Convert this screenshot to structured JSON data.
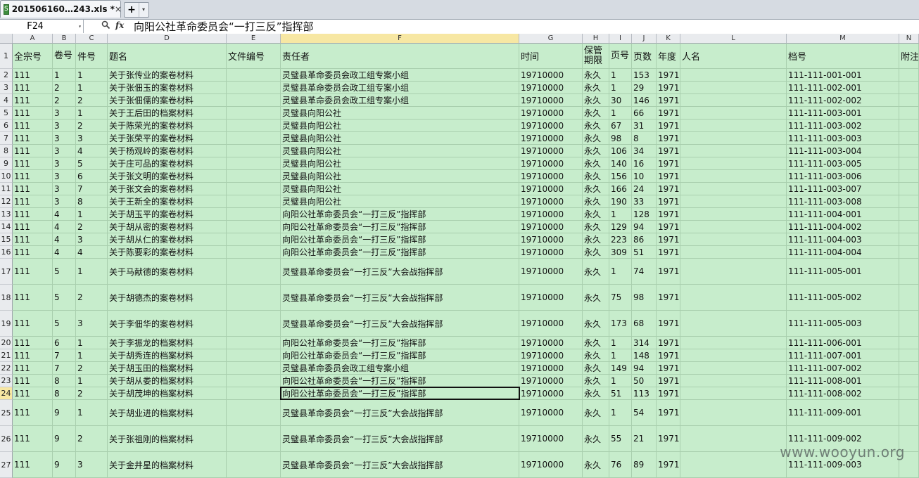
{
  "tab": {
    "title": "201506160…243.xls *",
    "close": "×"
  },
  "newtab": {
    "plus": "+",
    "dropdown": "▾"
  },
  "formula_bar": {
    "name_box": "F24",
    "fx": "fx",
    "formula": "向阳公社革命委员会“一打三反”指挥部"
  },
  "columns": [
    "A",
    "B",
    "C",
    "D",
    "E",
    "F",
    "G",
    "H",
    "I",
    "J",
    "K",
    "L",
    "M",
    "N"
  ],
  "header_row": [
    "全宗号",
    "卷号",
    "件号",
    "题名",
    "文件编号",
    "责任者",
    "时间",
    "保管期限",
    "页号",
    "页数",
    "年度",
    "人名",
    "档号",
    "附注"
  ],
  "rows": [
    [
      "111",
      "1",
      "1",
      "关于张传业的案卷材料",
      "",
      "灵璧县革命委员会政工组专案小组",
      "19710000",
      "永久",
      "1",
      "153",
      "1971",
      "",
      "111-111-001-001",
      ""
    ],
    [
      "111",
      "2",
      "1",
      "关于张佃玉的案卷材料",
      "",
      "灵璧县革命委员会政工组专案小组",
      "19710000",
      "永久",
      "1",
      "29",
      "1971",
      "",
      "111-111-002-001",
      ""
    ],
    [
      "111",
      "2",
      "2",
      "关于张佃儒的案卷材料",
      "",
      "灵璧县革命委员会政工组专案小组",
      "19710000",
      "永久",
      "30",
      "146",
      "1971",
      "",
      "111-111-002-002",
      ""
    ],
    [
      "111",
      "3",
      "1",
      "关于王后田的档案材料",
      "",
      "灵璧县向阳公社",
      "19710000",
      "永久",
      "1",
      "66",
      "1971",
      "",
      "111-111-003-001",
      ""
    ],
    [
      "111",
      "3",
      "2",
      "关于陈荣光的案卷材料",
      "",
      "灵璧县向阳公社",
      "19710000",
      "永久",
      "67",
      "31",
      "1971",
      "",
      "111-111-003-002",
      ""
    ],
    [
      "111",
      "3",
      "3",
      "关于张荣平的案卷材料",
      "",
      "灵璧县向阳公社",
      "19710000",
      "永久",
      "98",
      "8",
      "1971",
      "",
      "111-111-003-003",
      ""
    ],
    [
      "111",
      "3",
      "4",
      "关于杨观岭的案卷材料",
      "",
      "灵璧县向阳公社",
      "19710000",
      "永久",
      "106",
      "34",
      "1971",
      "",
      "111-111-003-004",
      ""
    ],
    [
      "111",
      "3",
      "5",
      "关于庄可品的案卷材料",
      "",
      "灵璧县向阳公社",
      "19710000",
      "永久",
      "140",
      "16",
      "1971",
      "",
      "111-111-003-005",
      ""
    ],
    [
      "111",
      "3",
      "6",
      "关于张文明的案卷材料",
      "",
      "灵璧县向阳公社",
      "19710000",
      "永久",
      "156",
      "10",
      "1971",
      "",
      "111-111-003-006",
      ""
    ],
    [
      "111",
      "3",
      "7",
      "关于张文会的案卷材料",
      "",
      "灵璧县向阳公社",
      "19710000",
      "永久",
      "166",
      "24",
      "1971",
      "",
      "111-111-003-007",
      ""
    ],
    [
      "111",
      "3",
      "8",
      "关于王新全的案卷材料",
      "",
      "灵璧县向阳公社",
      "19710000",
      "永久",
      "190",
      "33",
      "1971",
      "",
      "111-111-003-008",
      ""
    ],
    [
      "111",
      "4",
      "1",
      "关于胡玉平的案卷材料",
      "",
      "向阳公社革命委员会“一打三反”指挥部",
      "19710000",
      "永久",
      "1",
      "128",
      "1971",
      "",
      "111-111-004-001",
      ""
    ],
    [
      "111",
      "4",
      "2",
      "关于胡从密的案卷材料",
      "",
      "向阳公社革命委员会“一打三反”指挥部",
      "19710000",
      "永久",
      "129",
      "94",
      "1971",
      "",
      "111-111-004-002",
      ""
    ],
    [
      "111",
      "4",
      "3",
      "关于胡从仁的案卷材料",
      "",
      "向阳公社革命委员会“一打三反”指挥部",
      "19710000",
      "永久",
      "223",
      "86",
      "1971",
      "",
      "111-111-004-003",
      ""
    ],
    [
      "111",
      "4",
      "4",
      "关于陈要彩的案卷材料",
      "",
      "向阳公社革命委员会“一打三反”指挥部",
      "19710000",
      "永久",
      "309",
      "51",
      "1971",
      "",
      "111-111-004-004",
      ""
    ],
    [
      "111",
      "5",
      "1",
      "关于马献德的案卷材料",
      "",
      "灵璧县革命委员会“一打三反”大会战指挥部",
      "19710000",
      "永久",
      "1",
      "74",
      "1971",
      "",
      "111-111-005-001",
      ""
    ],
    [
      "111",
      "5",
      "2",
      "关于胡德杰的案卷材料",
      "",
      "灵璧县革命委员会“一打三反”大会战指挥部",
      "19710000",
      "永久",
      "75",
      "98",
      "1971",
      "",
      "111-111-005-002",
      ""
    ],
    [
      "111",
      "5",
      "3",
      "关于李佃华的案卷材料",
      "",
      "灵璧县革命委员会“一打三反”大会战指挥部",
      "19710000",
      "永久",
      "173",
      "68",
      "1971",
      "",
      "111-111-005-003",
      ""
    ],
    [
      "111",
      "6",
      "1",
      "关于李振龙的档案材料",
      "",
      "向阳公社革命委员会“一打三反”指挥部",
      "19710000",
      "永久",
      "1",
      "314",
      "1971",
      "",
      "111-111-006-001",
      ""
    ],
    [
      "111",
      "7",
      "1",
      "关于胡秀连的档案材料",
      "",
      "向阳公社革命委员会“一打三反”指挥部",
      "19710000",
      "永久",
      "1",
      "148",
      "1971",
      "",
      "111-111-007-001",
      ""
    ],
    [
      "111",
      "7",
      "2",
      "关于胡玉田的档案材料",
      "",
      "灵璧县革命委员会政工组专案小组",
      "19710000",
      "永久",
      "149",
      "94",
      "1971",
      "",
      "111-111-007-002",
      ""
    ],
    [
      "111",
      "8",
      "1",
      "关于胡从娄的档案材料",
      "",
      "向阳公社革命委员会“一打三反”指挥部",
      "19710000",
      "永久",
      "1",
      "50",
      "1971",
      "",
      "111-111-008-001",
      ""
    ],
    [
      "111",
      "8",
      "2",
      "关于胡茂坤的档案材料",
      "",
      "向阳公社革命委员会“一打三反”指挥部",
      "19710000",
      "永久",
      "51",
      "113",
      "1971",
      "",
      "111-111-008-002",
      ""
    ],
    [
      "111",
      "9",
      "1",
      "关于胡业进的档案材料",
      "",
      "灵璧县革命委员会“一打三反”大会战指挥部",
      "19710000",
      "永久",
      "1",
      "54",
      "1971",
      "",
      "111-111-009-001",
      ""
    ],
    [
      "111",
      "9",
      "2",
      "关于张祖刚的档案材料",
      "",
      "灵璧县革命委员会“一打三反”大会战指挥部",
      "19710000",
      "永久",
      "55",
      "21",
      "1971",
      "",
      "111-111-009-002",
      ""
    ],
    [
      "111",
      "9",
      "3",
      "关于金井星的档案材料",
      "",
      "灵璧县革命委员会“一打三反”大会战指挥部",
      "19710000",
      "永久",
      "76",
      "89",
      "1971",
      "",
      "111-111-009-003",
      ""
    ]
  ],
  "watermark": "www.wooyun.org"
}
